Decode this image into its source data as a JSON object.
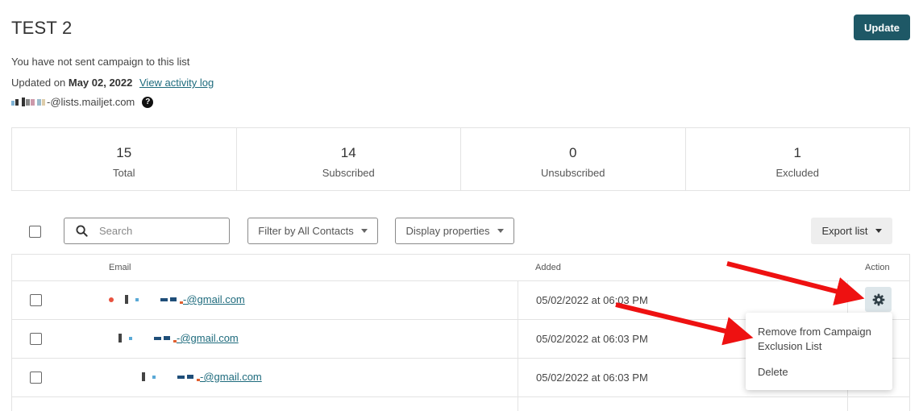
{
  "header": {
    "title": "TEST 2",
    "update_label": "Update"
  },
  "info": {
    "campaign_status": "You have not sent campaign to this list",
    "updated_prefix": "Updated on",
    "updated_date": "May 02, 2022",
    "activity_link": "View activity log",
    "list_address_suffix": "-@lists.mailjet.com",
    "help_glyph": "?"
  },
  "stats": [
    {
      "value": "15",
      "label": "Total"
    },
    {
      "value": "14",
      "label": "Subscribed"
    },
    {
      "value": "0",
      "label": "Unsubscribed"
    },
    {
      "value": "1",
      "label": "Excluded"
    }
  ],
  "toolbar": {
    "search_placeholder": "Search",
    "filter_label": "Filter by All Contacts",
    "display_label": "Display properties",
    "export_label": "Export list"
  },
  "table": {
    "columns": {
      "email": "Email",
      "added": "Added",
      "action": "Action"
    },
    "rows": [
      {
        "email_suffix": "-@gmail.com",
        "added": "05/02/2022 at 06:03 PM",
        "excluded": true
      },
      {
        "email_suffix": "-@gmail.com",
        "added": "05/02/2022 at 06:03 PM",
        "excluded": false
      },
      {
        "email_suffix": "-@gmail.com",
        "added": "05/02/2022 at 06:03 PM",
        "excluded": false
      }
    ]
  },
  "action_menu": {
    "remove_label": "Remove from Campaign Exclusion List",
    "delete_label": "Delete"
  },
  "colors": {
    "primary": "#1e5866",
    "link": "#1e6b7d",
    "excluded_dot": "#e8523f",
    "annotation_arrow": "#ee1111"
  }
}
